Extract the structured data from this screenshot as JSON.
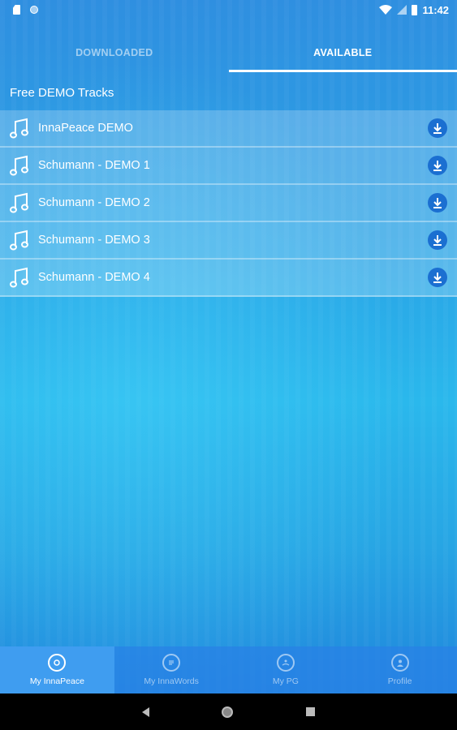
{
  "status": {
    "time": "11:42"
  },
  "tabs": [
    {
      "label": "DOWNLOADED",
      "active": false
    },
    {
      "label": "AVAILABLE",
      "active": true
    }
  ],
  "section": {
    "title": "Free DEMO Tracks"
  },
  "tracks": [
    {
      "label": "InnaPeace DEMO"
    },
    {
      "label": "Schumann - DEMO 1"
    },
    {
      "label": "Schumann - DEMO 2"
    },
    {
      "label": "Schumann - DEMO 3"
    },
    {
      "label": "Schumann - DEMO 4"
    }
  ],
  "bottom_nav": [
    {
      "label": "My InnaPeace",
      "active": true
    },
    {
      "label": "My InnaWords",
      "active": false
    },
    {
      "label": "My PG",
      "active": false
    },
    {
      "label": "Profile",
      "active": false
    }
  ],
  "colors": {
    "download_button": "#1b6fd1",
    "active_nav": "#3f9df0"
  }
}
